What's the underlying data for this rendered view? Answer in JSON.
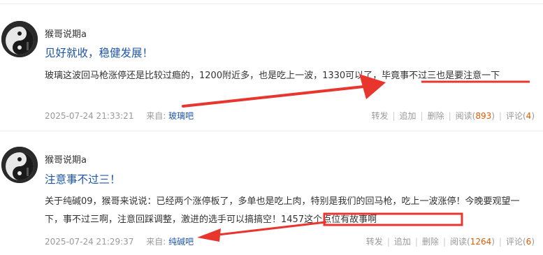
{
  "posts": [
    {
      "author": "猴哥说期a",
      "title": "见好就收，稳健发展！",
      "body": "玻璃这波回马枪涨停还是比较过瘾的，1200附近多，也是吃上一波，1330可以了，毕竟事不过三也是要注意一下",
      "time": "2025-07-24 21:33:21",
      "from_label": "来自:",
      "from": "玻璃吧",
      "actions": {
        "repost": "转发",
        "append": "追加",
        "delete": "删除",
        "read_label": "阅读",
        "read_count": "893",
        "comment_label": "评论",
        "comment_count": "4"
      }
    },
    {
      "author": "猴哥说期a",
      "title": "注意事不过三！",
      "body": "关于纯碱09，猴哥来说说：已经两个涨停板了，多单也是吃上肉，特别是我们的回马枪，吃上一波涨停！今晚要观望一下，事不过三啊，注意回踩调整，激进的选手可以搞搞空！1457这个点位有故事啊",
      "time": "2025-07-24 21:29:37",
      "from_label": "来自:",
      "from": "纯碱吧",
      "actions": {
        "repost": "转发",
        "append": "追加",
        "delete": "删除",
        "read_label": "阅读",
        "read_count": "1264",
        "comment_label": "评论",
        "comment_count": "6"
      }
    }
  ],
  "annotation_color": "#e8362f"
}
